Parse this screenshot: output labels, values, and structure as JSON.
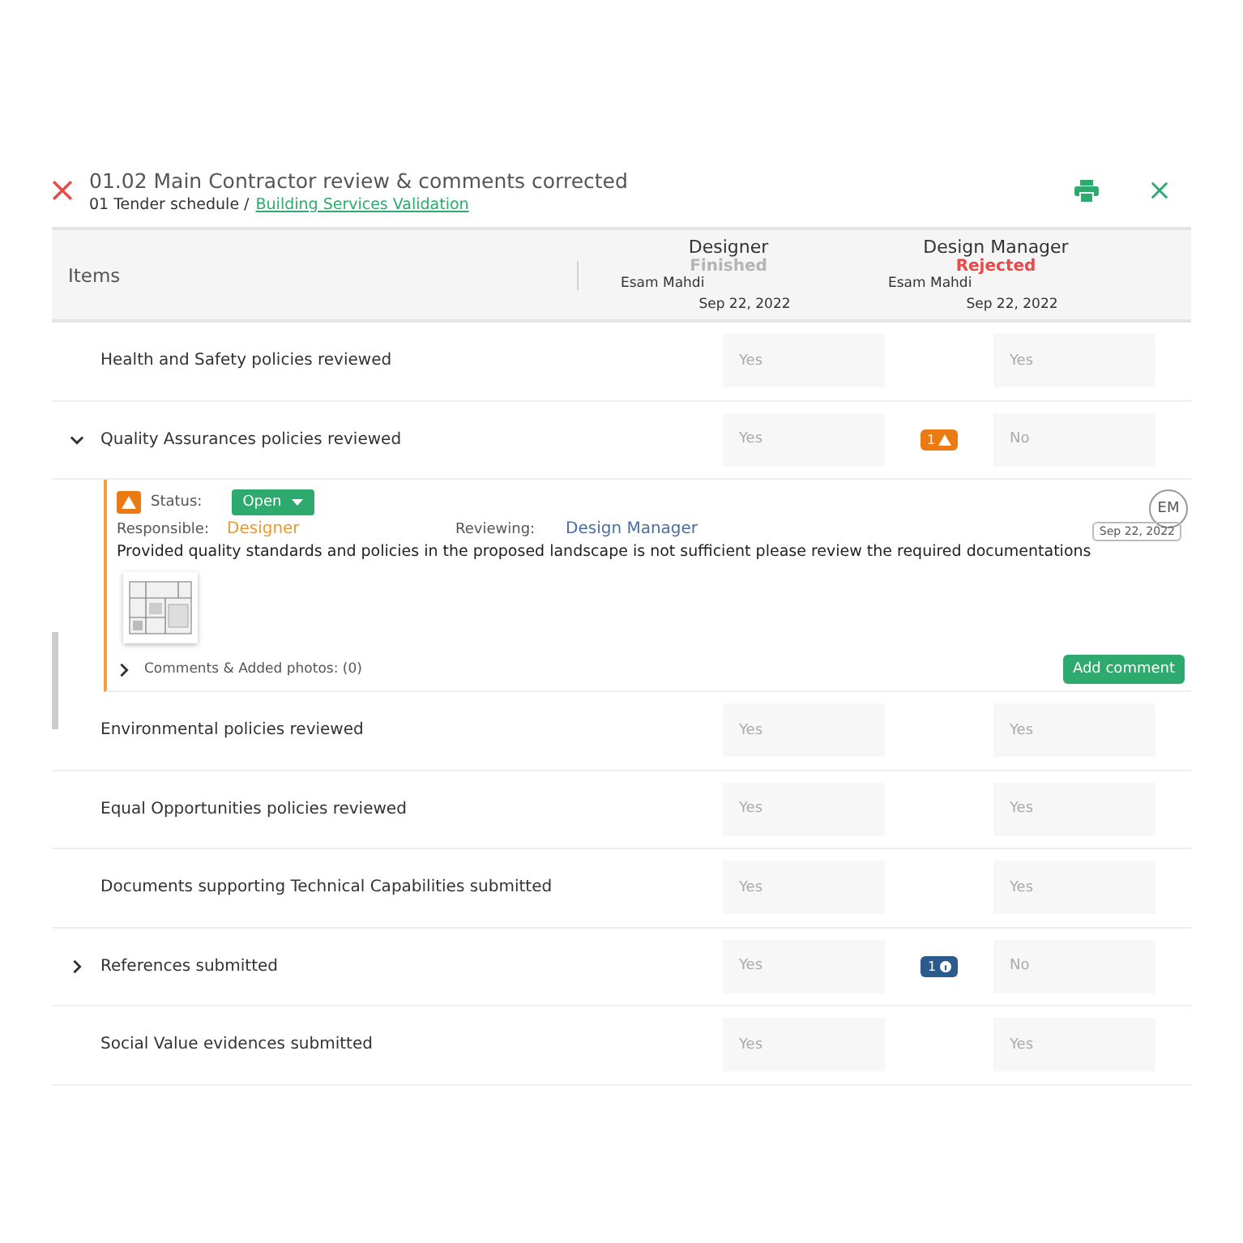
{
  "header": {
    "title": "01.02 Main Contractor review & comments corrected",
    "breadcrumb": "01 Tender schedule /",
    "breadcrumb_link": "Building Services Validation"
  },
  "columns": {
    "items_label": "Items",
    "reviewers": [
      {
        "role": "Designer",
        "status": "Finished",
        "rejected": false,
        "person": "Esam Mahdi",
        "date": "Sep 22, 2022"
      },
      {
        "role": "Design Manager",
        "status": "Rejected",
        "rejected": true,
        "person": "Esam Mahdi",
        "date": "Sep 22, 2022"
      }
    ]
  },
  "rows": [
    {
      "label": "Health and Safety policies reviewed",
      "answers": [
        "Yes",
        "Yes"
      ]
    },
    {
      "label": "Quality Assurances policies reviewed",
      "expanded": true,
      "answers": [
        "Yes",
        "No"
      ],
      "badge": {
        "kind": "warning",
        "count": "1"
      },
      "issue": {
        "status_label": "Status:",
        "status": "Open",
        "responsible_label": "Responsible:",
        "responsible": "Designer",
        "reviewing_label": "Reviewing:",
        "reviewing": "Design Manager",
        "avatar": "EM",
        "date": "Sep 22, 2022",
        "text": "Provided quality standards and policies in the proposed landscape is not sufficient please review the required documentations",
        "comments": "Comments & Added photos: (0)",
        "add_button": "Add comment"
      }
    },
    {
      "label": "Environmental policies reviewed",
      "answers": [
        "Yes",
        "Yes"
      ]
    },
    {
      "label": "Equal Opportunities policies reviewed",
      "answers": [
        "Yes",
        "Yes"
      ]
    },
    {
      "label": "Documents supporting Technical Capabilities submitted",
      "answers": [
        "Yes",
        "Yes"
      ]
    },
    {
      "label": "References submitted",
      "expanded": false,
      "answers": [
        "Yes",
        "No"
      ],
      "badge": {
        "kind": "info",
        "count": "1"
      }
    },
    {
      "label": "Social Value evidences submitted",
      "answers": [
        "Yes",
        "Yes"
      ]
    }
  ]
}
